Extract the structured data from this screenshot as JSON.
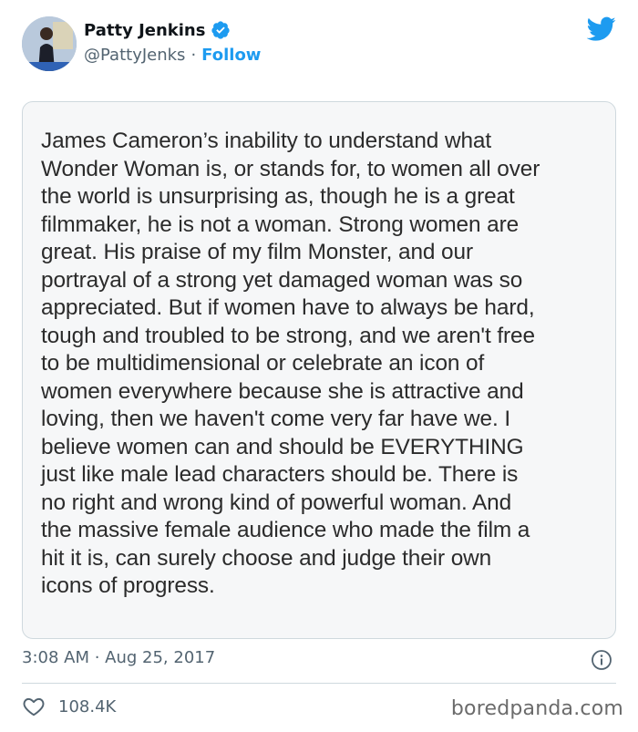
{
  "author": {
    "display_name": "Patty Jenkins",
    "handle": "@PattyJenks",
    "separator": "·",
    "follow_label": "Follow"
  },
  "icons": {
    "avatar": "profile-photo",
    "verified": "verified-badge-icon",
    "twitter": "twitter-bird-icon",
    "info": "info-icon",
    "like": "heart-icon"
  },
  "colors": {
    "accent": "#1d9bf0",
    "muted_text": "#536471",
    "border": "#cfd9de"
  },
  "statement": {
    "lines": [
      "James Cameron’s inability to understand what",
      "Wonder Woman is, or stands for, to women all over",
      "the world is unsurprising as, though he is a great",
      "filmmaker, he is not a woman. Strong women are",
      "great. His praise of my film Monster, and our",
      "portrayal of a strong yet damaged woman was so",
      "appreciated. But if women have to always be hard,",
      "tough and troubled to be strong, and we aren't free",
      "to be multidimensional or celebrate an icon of",
      "women everywhere because she is attractive and",
      "loving, then we haven't come very far have we. I",
      "believe women can and should be EVERYTHING",
      "just like male lead characters should be. There is",
      "no right and wrong kind of powerful woman. And",
      "the massive female audience who made the film a",
      "hit it is, can surely choose and judge their own",
      "icons of progress."
    ]
  },
  "meta": {
    "timestamp": "3:08 AM · Aug 25, 2017"
  },
  "engagement": {
    "likes": "108.4K"
  },
  "watermark": "boredpanda.com"
}
